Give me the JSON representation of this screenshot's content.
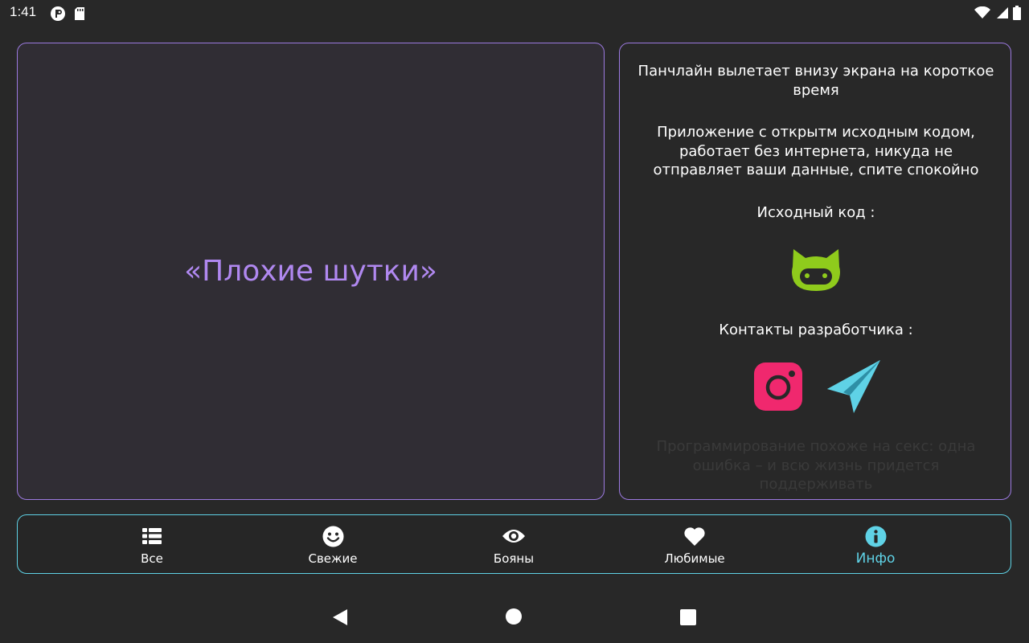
{
  "status_bar": {
    "time": "1:41",
    "left_icons": [
      "app-notification-icon",
      "sd-card-icon"
    ],
    "right_icons": [
      "wifi-icon",
      "cell-signal-icon",
      "battery-icon"
    ]
  },
  "main_panel": {
    "title": "«Плохие шутки»"
  },
  "info_panel": {
    "punchline_note": "Панчлайн вылетает внизу экрана на короткое время",
    "open_source_note": "Приложение с открытм исходным кодом, работает без интернета, никуда не отправляет ваши данные, спите спокойно",
    "source_code_label": "Исходный код :",
    "developer_contacts_label": "Контакты разработчика :",
    "punchline_text": "Программирование похоже на секс: одна ошибка – и всю жизнь придется поддерживать",
    "links": [
      "github-icon",
      "instagram-icon",
      "telegram-icon"
    ]
  },
  "bottom_nav": {
    "items": [
      {
        "label": "Все",
        "icon": "list-icon",
        "active": false
      },
      {
        "label": "Свежие",
        "icon": "smile-icon",
        "active": false
      },
      {
        "label": "Бояны",
        "icon": "eye-icon",
        "active": false
      },
      {
        "label": "Любимые",
        "icon": "heart-icon",
        "active": false
      },
      {
        "label": "Инфо",
        "icon": "info-icon",
        "active": true
      }
    ]
  },
  "colors": {
    "background": "#282828",
    "accent_purple": "#b088f0",
    "accent_cyan": "#5fd2e6",
    "github_green": "#8fcb1c",
    "instagram_pink": "#f0286e",
    "telegram_blue": "#5fd2e6"
  },
  "system_nav": [
    "back-icon",
    "home-icon",
    "recents-icon"
  ]
}
